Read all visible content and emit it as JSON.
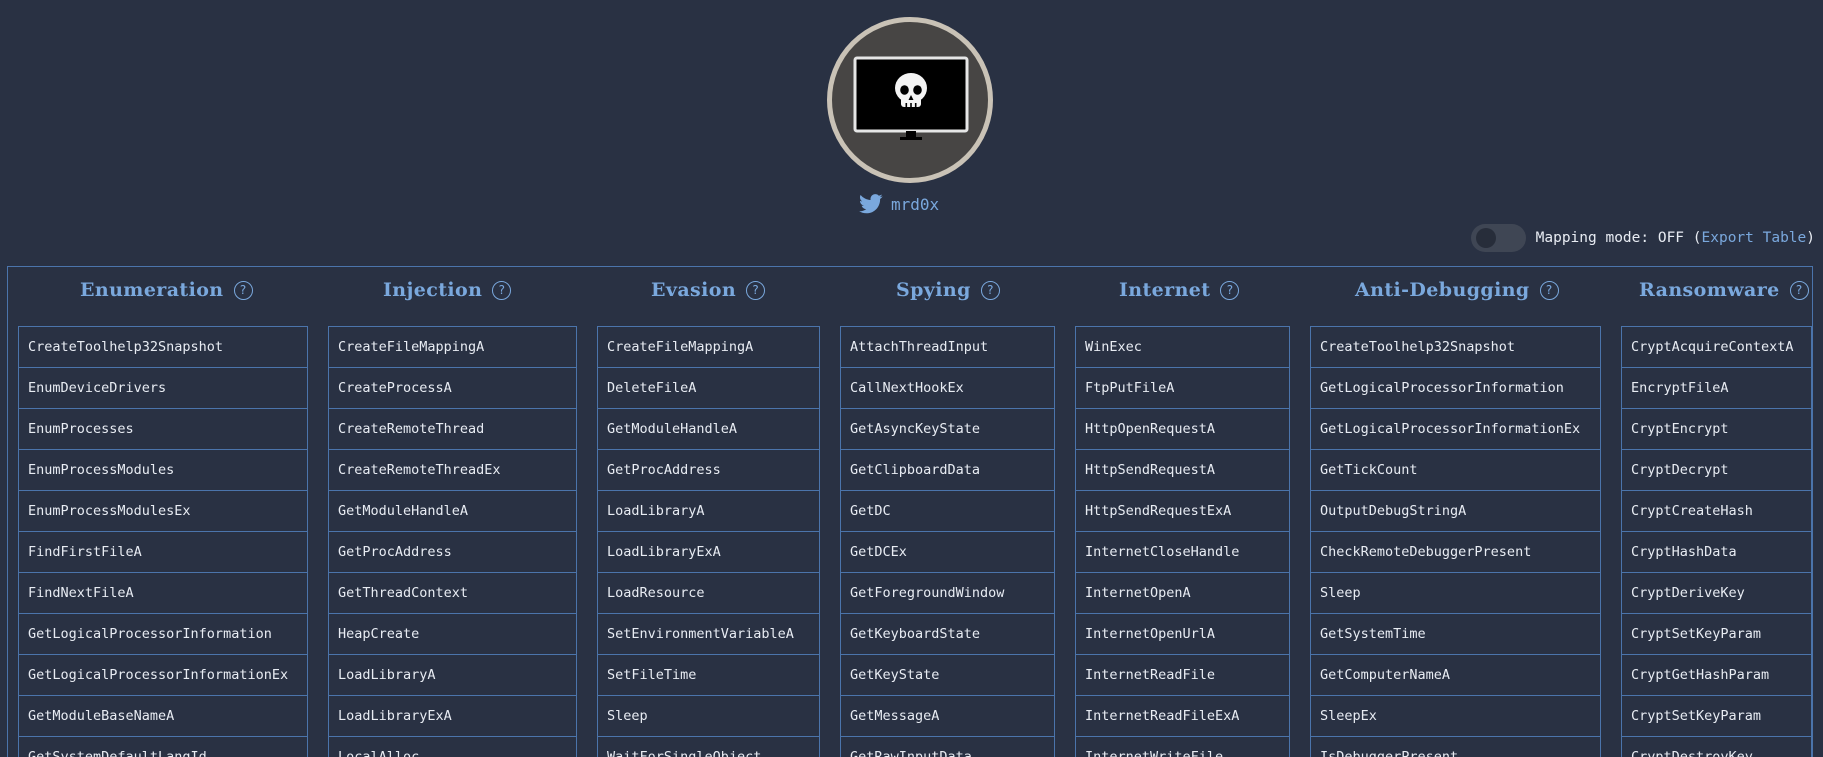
{
  "profile": {
    "handle": "mrd0x",
    "avatar_icon": "skull-monitor-icon",
    "twitter_icon": "twitter-bird-icon"
  },
  "mapping": {
    "label": "Mapping mode: OFF (",
    "export_label": "Export Table",
    "close_paren": ")",
    "toggle_state": "off"
  },
  "colors": {
    "background": "#293143",
    "accent": "#7aa8dd",
    "border": "#4b74ab",
    "text": "#e8ecf3"
  },
  "columns": [
    {
      "title": "Enumeration",
      "help": "?",
      "items": [
        "CreateToolhelp32Snapshot",
        "EnumDeviceDrivers",
        "EnumProcesses",
        "EnumProcessModules",
        "EnumProcessModulesEx",
        "FindFirstFileA",
        "FindNextFileA",
        "GetLogicalProcessorInformation",
        "GetLogicalProcessorInformationEx",
        "GetModuleBaseNameA",
        "GetSystemDefaultLangId"
      ]
    },
    {
      "title": "Injection",
      "help": "?",
      "items": [
        "CreateFileMappingA",
        "CreateProcessA",
        "CreateRemoteThread",
        "CreateRemoteThreadEx",
        "GetModuleHandleA",
        "GetProcAddress",
        "GetThreadContext",
        "HeapCreate",
        "LoadLibraryA",
        "LoadLibraryExA",
        "LocalAlloc"
      ]
    },
    {
      "title": "Evasion",
      "help": "?",
      "items": [
        "CreateFileMappingA",
        "DeleteFileA",
        "GetModuleHandleA",
        "GetProcAddress",
        "LoadLibraryA",
        "LoadLibraryExA",
        "LoadResource",
        "SetEnvironmentVariableA",
        "SetFileTime",
        "Sleep",
        "WaitForSingleObject"
      ]
    },
    {
      "title": "Spying",
      "help": "?",
      "items": [
        "AttachThreadInput",
        "CallNextHookEx",
        "GetAsyncKeyState",
        "GetClipboardData",
        "GetDC",
        "GetDCEx",
        "GetForegroundWindow",
        "GetKeyboardState",
        "GetKeyState",
        "GetMessageA",
        "GetRawInputData"
      ]
    },
    {
      "title": "Internet",
      "help": "?",
      "items": [
        "WinExec",
        "FtpPutFileA",
        "HttpOpenRequestA",
        "HttpSendRequestA",
        "HttpSendRequestExA",
        "InternetCloseHandle",
        "InternetOpenA",
        "InternetOpenUrlA",
        "InternetReadFile",
        "InternetReadFileExA",
        "InternetWriteFile"
      ]
    },
    {
      "title": "Anti-Debugging",
      "help": "?",
      "items": [
        "CreateToolhelp32Snapshot",
        "GetLogicalProcessorInformation",
        "GetLogicalProcessorInformationEx",
        "GetTickCount",
        "OutputDebugStringA",
        "CheckRemoteDebuggerPresent",
        "Sleep",
        "GetSystemTime",
        "GetComputerNameA",
        "SleepEx",
        "IsDebuggerPresent"
      ]
    },
    {
      "title": "Ransomware",
      "help": "?",
      "items": [
        "CryptAcquireContextA",
        "EncryptFileA",
        "CryptEncrypt",
        "CryptDecrypt",
        "CryptCreateHash",
        "CryptHashData",
        "CryptDeriveKey",
        "CryptSetKeyParam",
        "CryptGetHashParam",
        "CryptSetKeyParam",
        "CryptDestroyKey"
      ]
    }
  ]
}
